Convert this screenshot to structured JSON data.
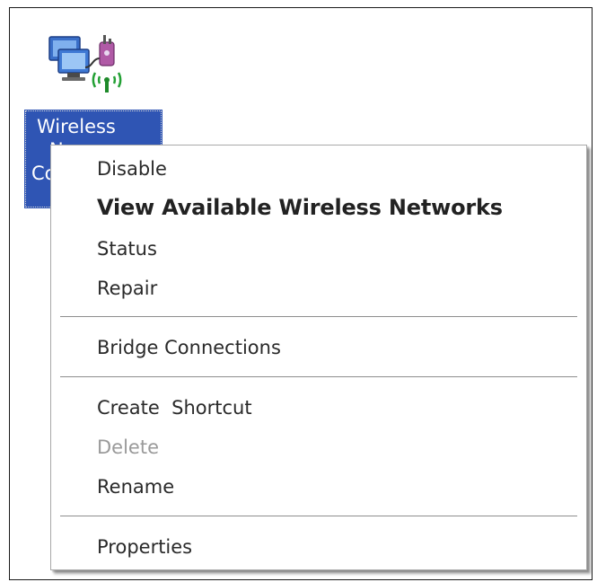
{
  "desktop_icon": {
    "icon_name": "wireless-network-connection-icon",
    "label_lines": [
      "Wireless",
      "N",
      "Co"
    ],
    "selected_color": "#2f55b4"
  },
  "context_menu": {
    "items": [
      {
        "label": "Disable",
        "bold": false,
        "enabled": true
      },
      {
        "label": "View Available Wireless Networks",
        "bold": true,
        "enabled": true
      },
      {
        "label": "Status",
        "bold": false,
        "enabled": true
      },
      {
        "label": "Repair",
        "bold": false,
        "enabled": true
      },
      {
        "label": "Bridge Connections",
        "bold": false,
        "enabled": true
      },
      {
        "label": "Create  Shortcut",
        "bold": false,
        "enabled": true
      },
      {
        "label": "Delete",
        "bold": false,
        "enabled": false
      },
      {
        "label": "Rename",
        "bold": false,
        "enabled": true
      },
      {
        "label": "Properties",
        "bold": false,
        "enabled": true
      }
    ]
  }
}
